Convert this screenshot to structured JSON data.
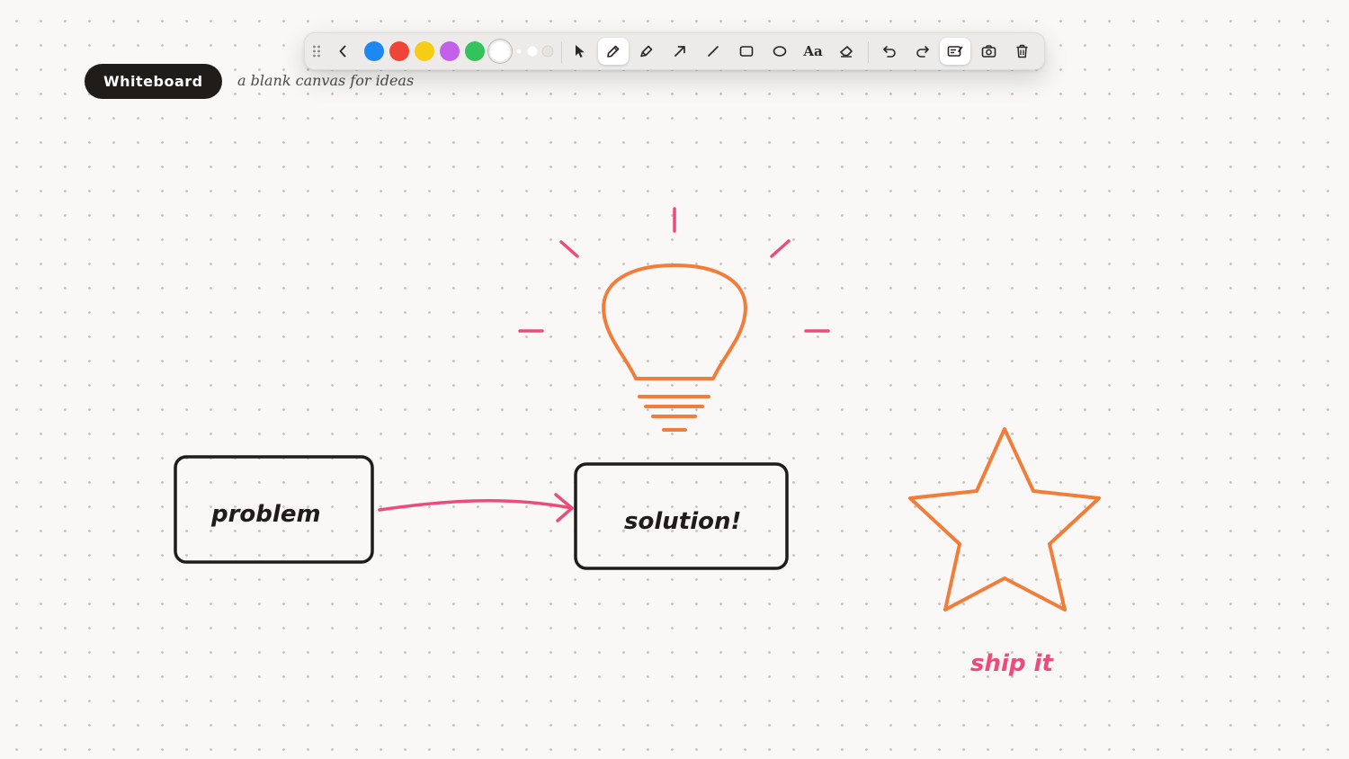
{
  "app": {
    "title": "Whiteboard",
    "subtitle": "a blank canvas for ideas"
  },
  "toolbar": {
    "colors": [
      {
        "name": "blue",
        "hex": "#1e88f0",
        "selected": false
      },
      {
        "name": "red",
        "hex": "#f04438",
        "selected": false
      },
      {
        "name": "yellow",
        "hex": "#f7cc16",
        "selected": false
      },
      {
        "name": "purple",
        "hex": "#c260ec",
        "selected": false
      },
      {
        "name": "green",
        "hex": "#33c35a",
        "selected": false
      },
      {
        "name": "white",
        "hex": "#ffffff",
        "selected": true
      }
    ],
    "stroke_sizes": [
      "small",
      "medium",
      "large"
    ],
    "tools": [
      "drag-handle-icon",
      "collapse-chevron-icon",
      "select-pointer-icon",
      "pen-icon",
      "highlighter-icon",
      "arrow-tool-icon",
      "line-tool-icon",
      "rectangle-tool-icon",
      "ellipse-tool-icon",
      "text-tool-icon",
      "eraser-icon",
      "undo-icon",
      "redo-icon",
      "sticky-note-icon",
      "camera-icon",
      "trash-icon"
    ],
    "active_tool": "pen",
    "text_tool_label": "Aa"
  },
  "canvas": {
    "ink_colors": {
      "black": "#1f1c1a",
      "pink": "#ec4c7c",
      "orange": "#f07d3a"
    },
    "labels": {
      "problem": "problem",
      "solution": "solution!",
      "ship": "ship it"
    }
  }
}
